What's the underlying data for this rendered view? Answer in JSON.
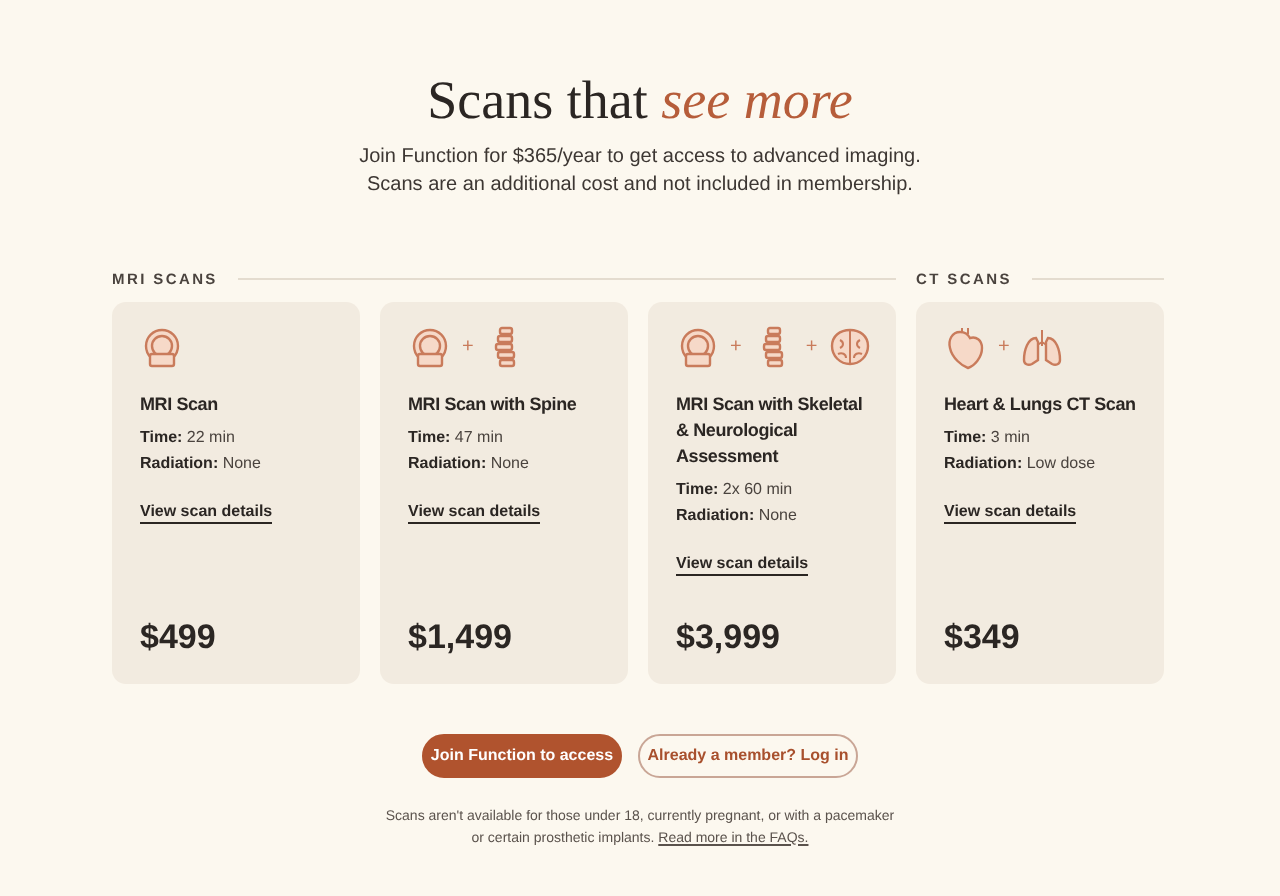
{
  "heading": "Scans that *see more*",
  "intro": [
    "Join Function for $365/year to get access to advanced imaging.",
    "Scans are an additional cost and not included in membership."
  ],
  "sections": [
    {
      "title": "MRI SCANS",
      "cards": [
        {
          "icons": [
            {
              "kind": "scanner"
            }
          ],
          "name": "MRI Scan",
          "details": [
            {
              "label": "Time:",
              "value": "22 min"
            },
            {
              "label": "Radiation:",
              "value": "None"
            }
          ],
          "link": "View scan details",
          "price": "$499"
        },
        {
          "icons": [
            {
              "kind": "scanner"
            },
            {
              "kind": "plus",
              "text": "+"
            },
            {
              "kind": "spine"
            }
          ],
          "name": "MRI Scan with Spine",
          "details": [
            {
              "label": "Time:",
              "value": "47 min"
            },
            {
              "label": "Radiation:",
              "value": "None"
            }
          ],
          "link": "View scan details",
          "price": "$1,499"
        },
        {
          "icons": [
            {
              "kind": "scanner"
            },
            {
              "kind": "plus",
              "text": "+"
            },
            {
              "kind": "spine"
            },
            {
              "kind": "plus",
              "text": "+"
            },
            {
              "kind": "brain"
            }
          ],
          "name": "MRI Scan with Skeletal & Neurological Assessment",
          "details": [
            {
              "label": "Time:",
              "value": "2x 60 min"
            },
            {
              "label": "Radiation:",
              "value": "None"
            }
          ],
          "link": "View scan details",
          "price": "$3,999"
        }
      ]
    },
    {
      "title": "CT SCANS",
      "cards": [
        {
          "icons": [
            {
              "kind": "heart"
            },
            {
              "kind": "plus",
              "text": "+"
            },
            {
              "kind": "lungs"
            }
          ],
          "name": "Heart & Lungs CT Scan",
          "details": [
            {
              "label": "Time:",
              "value": "3 min"
            },
            {
              "label": "Radiation:",
              "value": "Low dose"
            }
          ],
          "link": "View scan details",
          "price": "$349"
        }
      ]
    }
  ],
  "buttons": [
    {
      "label": "Join Function to access",
      "kind": "primary"
    },
    {
      "label": "Already a member? Log in",
      "kind": "outline"
    }
  ],
  "footnote": "Scans aren't available for those under 18, currently pregnant, or with a pacemaker or certain prosthetic implants.",
  "footnote_link": "Read more in the FAQs."
}
